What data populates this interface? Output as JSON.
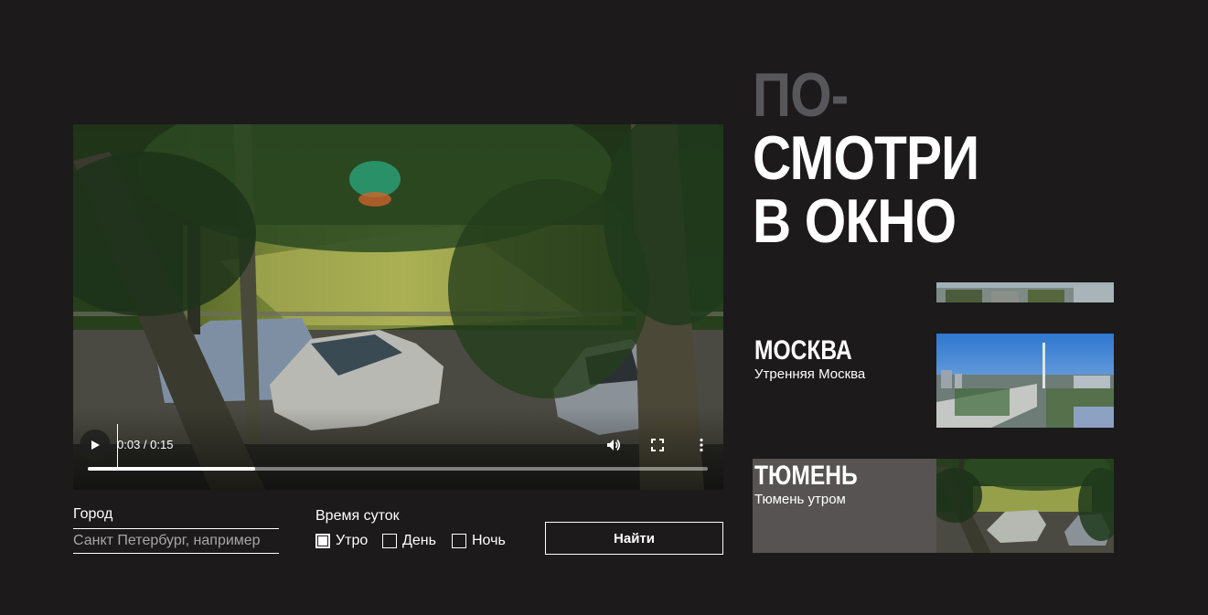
{
  "video": {
    "time": "0:03 / 0:15",
    "progress": 0.27,
    "icons": [
      "play-icon",
      "volume-icon",
      "fullscreen-icon",
      "more-vert-icon"
    ]
  },
  "form": {
    "city_label": "Город",
    "city_placeholder": "Санкт Петербург, например",
    "time_label": "Время суток",
    "options": [
      {
        "label": "Утро",
        "checked": true
      },
      {
        "label": "День",
        "checked": false
      },
      {
        "label": "Ночь",
        "checked": false
      }
    ],
    "submit_label": "Найти"
  },
  "title": {
    "line1": "ПО-",
    "line2": "СМОТРИ",
    "line3": "В ОКНО"
  },
  "cities": [
    {
      "name": "МОСКВА",
      "subtitle": "Утренняя Москва"
    },
    {
      "name": "ТЮМЕНЬ",
      "subtitle": "Тюмень утром"
    }
  ],
  "colors": {
    "background": "#1c1a1b",
    "title_dim": "#57575a",
    "card_active": "#575352"
  }
}
